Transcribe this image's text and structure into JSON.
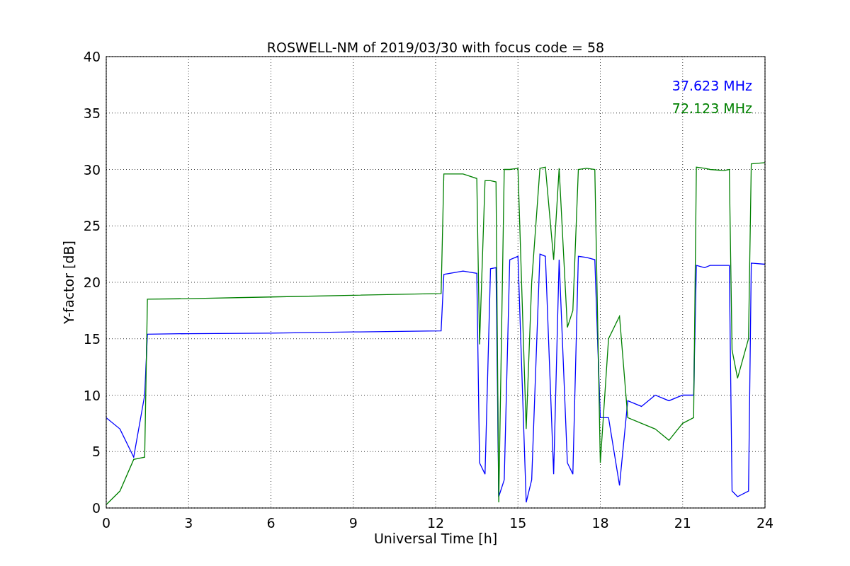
{
  "chart_data": {
    "type": "line",
    "title": "ROSWELL-NM of 2019/03/30 with focus code = 58",
    "xlabel": "Universal Time [h]",
    "ylabel": "Y-factor [dB]",
    "x": [
      0,
      0.5,
      1,
      1.4,
      1.5,
      3,
      6,
      9,
      12.2,
      12.3,
      13,
      13.5,
      13.6,
      13.8,
      14,
      14.2,
      14.3,
      14.5,
      14.7,
      15,
      15.3,
      15.5,
      15.8,
      16,
      16.3,
      16.5,
      16.8,
      17,
      17.2,
      17.5,
      17.8,
      18,
      18.3,
      18.7,
      19,
      19.5,
      20,
      20.5,
      21,
      21.4,
      21.5,
      21.8,
      22,
      22.5,
      22.7,
      22.8,
      23,
      23.4,
      23.5,
      24
    ],
    "series": [
      {
        "name": "37.623 MHz",
        "color": "#0000ff",
        "values": [
          8,
          7,
          4.5,
          10,
          15.4,
          15.45,
          15.5,
          15.6,
          15.7,
          20.7,
          21,
          20.8,
          4,
          3,
          21.2,
          21.3,
          1,
          2.5,
          22,
          22.3,
          0.5,
          2.5,
          22.5,
          22.3,
          3,
          22,
          4,
          3,
          22.3,
          22.2,
          22,
          8,
          8,
          2,
          9.5,
          9,
          10,
          9.5,
          10,
          10,
          21.5,
          21.3,
          21.5,
          21.5,
          21.5,
          1.5,
          1,
          1.5,
          21.7,
          21.6
        ]
      },
      {
        "name": "72.123 MHz",
        "color": "#008000",
        "values": [
          0.3,
          1.5,
          4.3,
          4.5,
          18.5,
          18.55,
          18.7,
          18.85,
          19,
          29.6,
          29.6,
          29.2,
          14.5,
          29,
          29,
          28.9,
          0.5,
          30,
          30,
          30.1,
          7,
          20,
          30.1,
          30.2,
          22,
          30.1,
          16,
          17.5,
          30,
          30.1,
          30,
          4,
          15,
          17,
          8,
          7.5,
          7,
          6,
          7.5,
          8,
          30.2,
          30.1,
          30,
          29.9,
          30,
          14,
          11.5,
          15,
          30.5,
          30.6
        ]
      }
    ],
    "xlim": [
      0,
      24
    ],
    "ylim": [
      0,
      40
    ],
    "xticks": [
      0,
      3,
      6,
      9,
      12,
      15,
      18,
      21,
      24
    ],
    "yticks": [
      0,
      5,
      10,
      15,
      20,
      25,
      30,
      35,
      40
    ],
    "grid": true
  }
}
